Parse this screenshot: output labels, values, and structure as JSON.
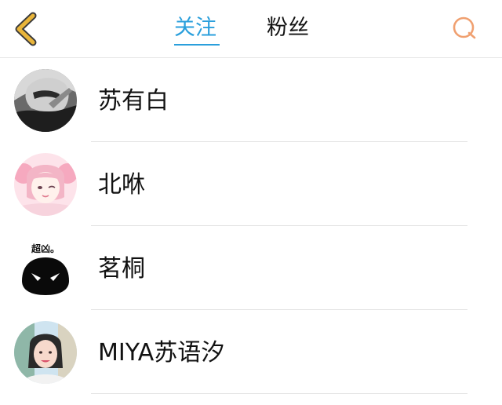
{
  "header": {
    "back_icon": "chevron-left-icon",
    "search_icon": "search-icon",
    "accent_color": "#2a9fdc",
    "back_color": "#e9b53a",
    "search_color": "#f0a070",
    "tabs": [
      {
        "label": "关注",
        "active": true
      },
      {
        "label": "粉丝",
        "active": false
      }
    ]
  },
  "follow_list": [
    {
      "name": "苏有白"
    },
    {
      "name": "北咻"
    },
    {
      "name": "茗桐",
      "avatar_text": "超凶。"
    },
    {
      "name": "MIYA苏语汐"
    }
  ]
}
